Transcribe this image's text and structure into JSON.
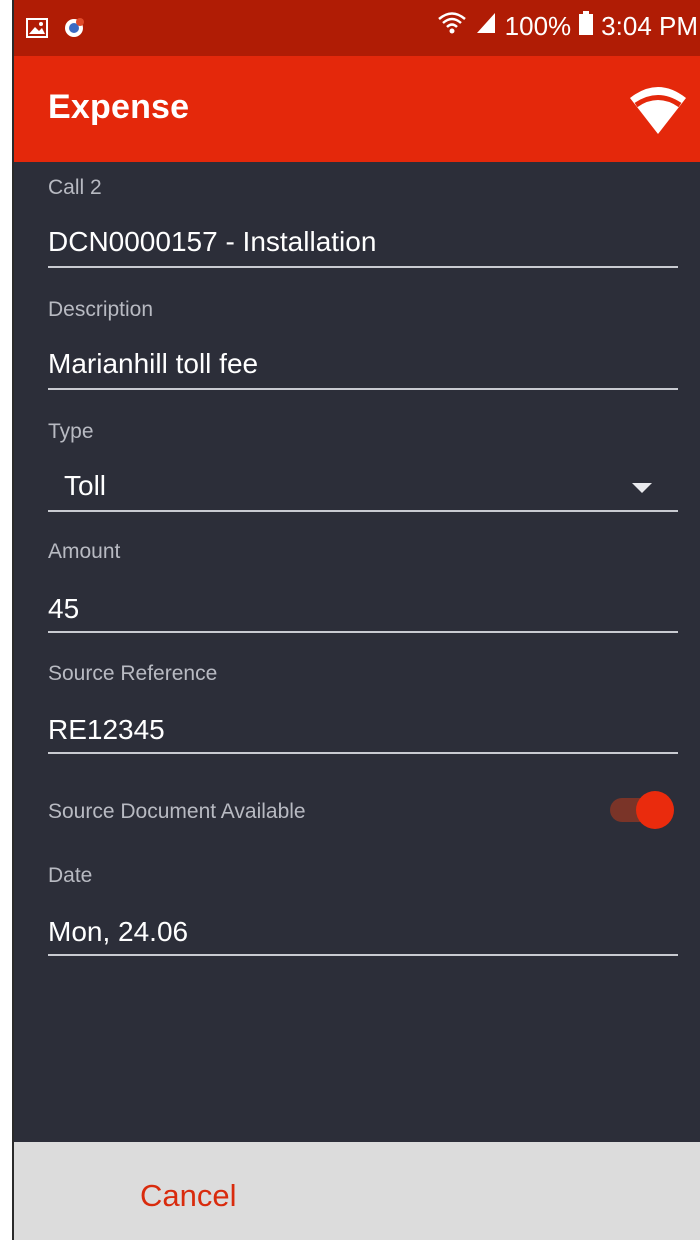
{
  "status_bar": {
    "battery": "100%",
    "time": "3:04 PM",
    "left_icons": [
      "gallery-icon",
      "app-notification-icon"
    ],
    "right_icons": [
      "wifi-status-icon",
      "signal-icon",
      "battery-icon"
    ]
  },
  "app_bar": {
    "title": "Expense",
    "connectivity_icon": "wifi-icon",
    "color": "#e4280b"
  },
  "form": {
    "call": {
      "label": "Call 2",
      "value": "DCN0000157 - Installation"
    },
    "description": {
      "label": "Description",
      "value": "Marianhill toll fee"
    },
    "type": {
      "label": "Type",
      "value": "Toll"
    },
    "amount": {
      "label": "Amount",
      "value": "45"
    },
    "source_reference": {
      "label": "Source Reference",
      "value": "RE12345"
    },
    "source_document": {
      "label": "Source Document Available",
      "checked": true
    },
    "date": {
      "label": "Date",
      "value": "Mon, 24.06"
    }
  },
  "footer": {
    "cancel_label": "Cancel"
  },
  "colors": {
    "accent": "#e4280b",
    "status_bar": "#b01c05",
    "background": "#2c2e39"
  }
}
